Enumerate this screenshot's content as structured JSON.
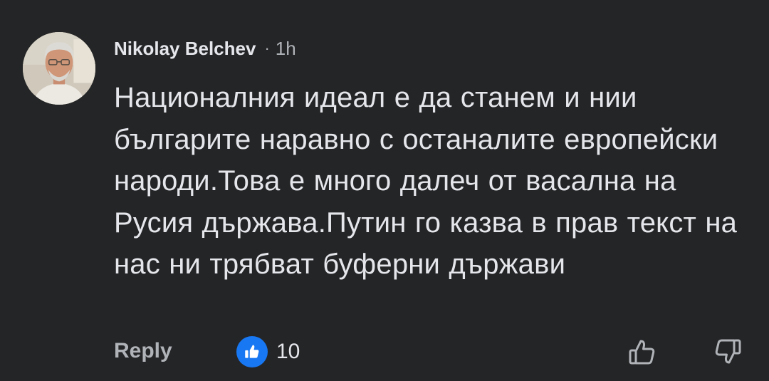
{
  "comment": {
    "author": "Nikolay Belchev",
    "separator": "·",
    "timestamp": "1h",
    "body": "Националния идеал е да станем и нии българите наравно с останалите европейски народи.Това е много далеч от васална на Русия държава.Путин го казва в прав текст на нас ни трябват буферни държави"
  },
  "actions": {
    "reply_label": "Reply",
    "reaction_type": "like",
    "reaction_count": "10",
    "upvote_icon": "thumbs-up-outline-icon",
    "downvote_icon": "thumbs-down-outline-icon"
  },
  "colors": {
    "background": "#242526",
    "primary_text": "#e4e6eb",
    "secondary_text": "#b0b3b8",
    "like_blue": "#1877f2"
  }
}
